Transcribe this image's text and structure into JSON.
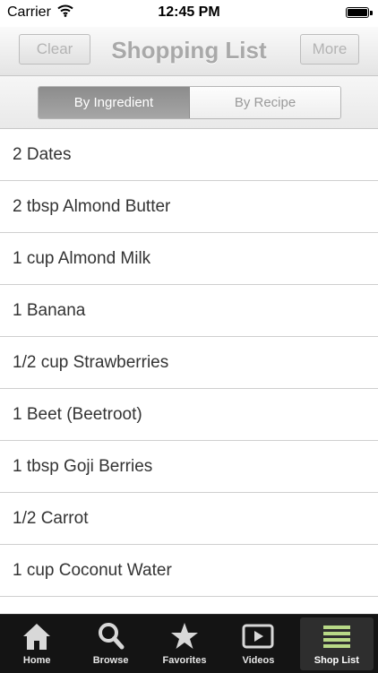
{
  "status_bar": {
    "carrier": "Carrier",
    "time": "12:45 PM"
  },
  "nav": {
    "title": "Shopping List",
    "left_button": "Clear",
    "right_button": "More"
  },
  "segmented": {
    "options": [
      "By Ingredient",
      "By Recipe"
    ],
    "selected": "By Ingredient"
  },
  "list": {
    "items": [
      "2 Dates",
      "2 tbsp Almond Butter",
      "1 cup Almond Milk",
      "1 Banana",
      "1/2 cup Strawberries",
      "1 Beet (Beetroot)",
      "1 tbsp Goji Berries",
      "1/2 Carrot",
      "1 cup Coconut Water"
    ]
  },
  "tab_bar": {
    "tabs": [
      {
        "label": "Home",
        "icon": "home-icon"
      },
      {
        "label": "Browse",
        "icon": "search-icon"
      },
      {
        "label": "Favorites",
        "icon": "star-icon"
      },
      {
        "label": "Videos",
        "icon": "play-icon"
      },
      {
        "label": "Shop List",
        "icon": "list-icon"
      }
    ],
    "selected": "Shop List",
    "accent_color": "#b8d987"
  }
}
